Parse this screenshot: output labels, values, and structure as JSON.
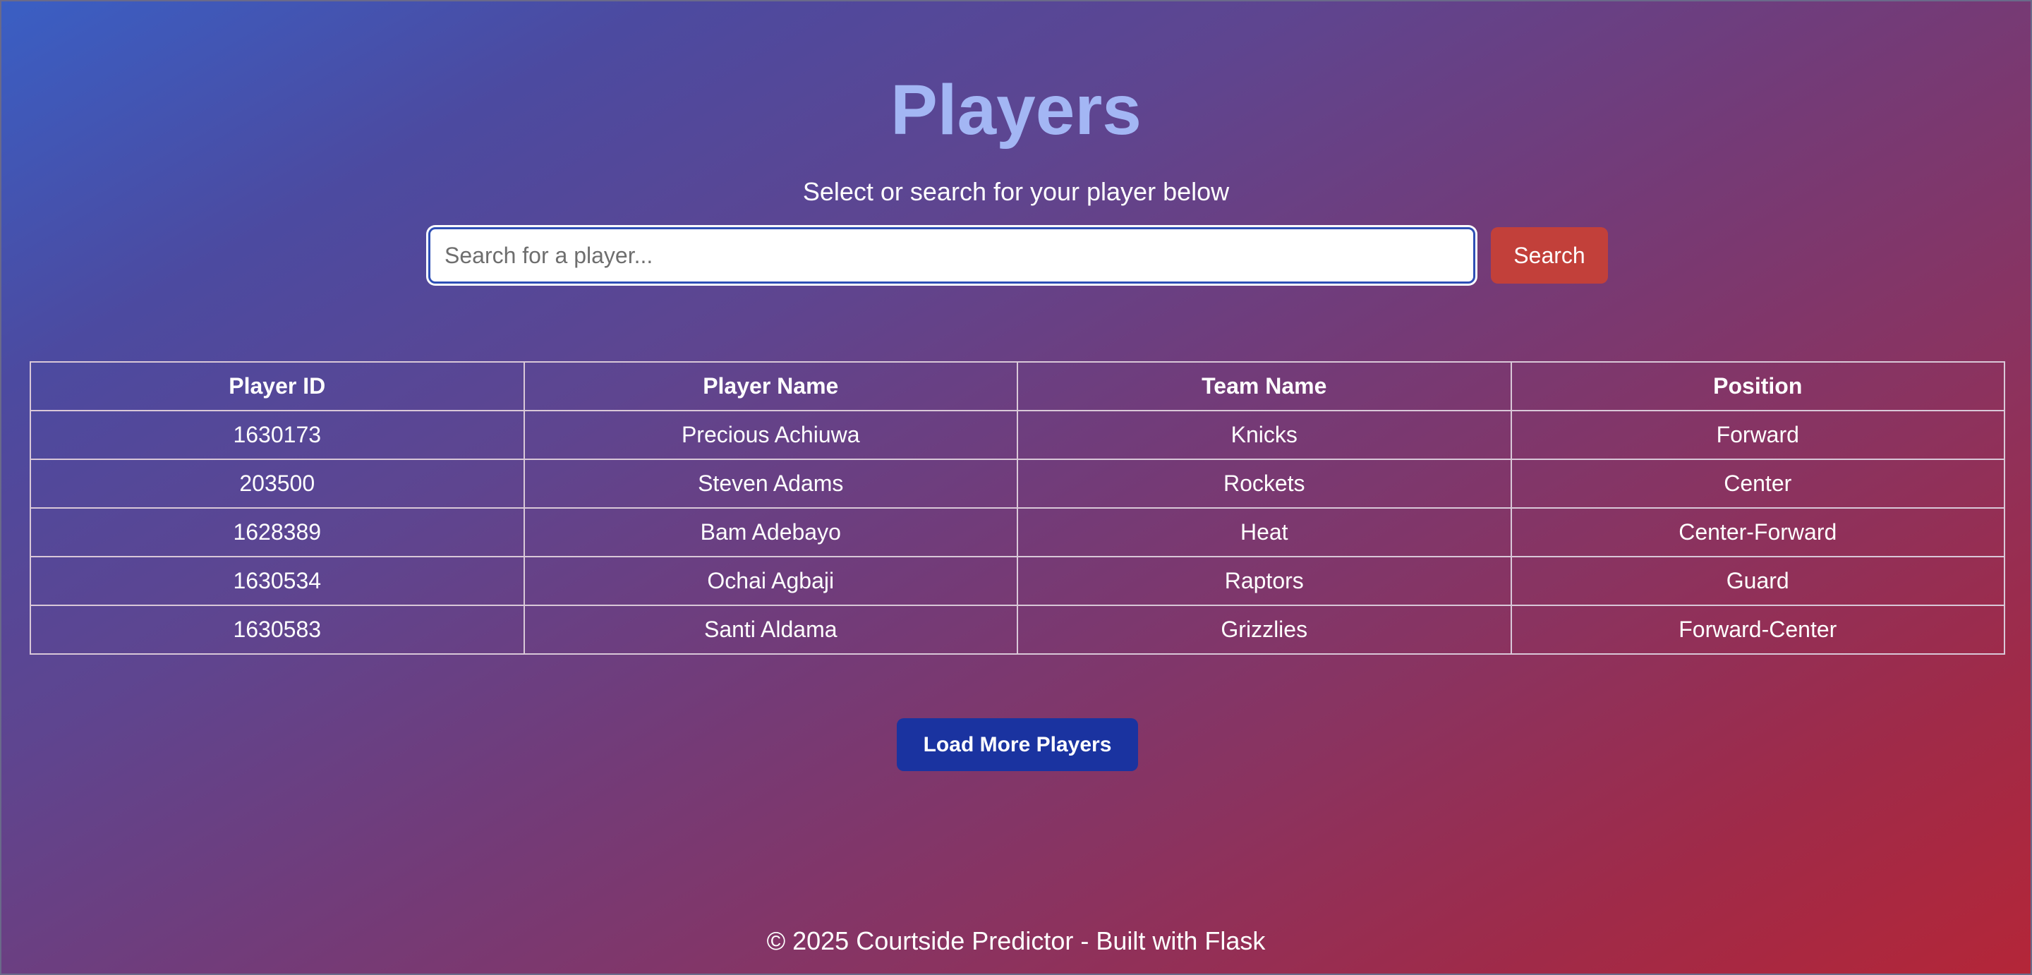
{
  "page": {
    "title": "Players",
    "subtitle": "Select or search for your player below"
  },
  "search": {
    "placeholder": "Search for a player...",
    "value": "",
    "button_label": "Search"
  },
  "table": {
    "columns": [
      "Player ID",
      "Player Name",
      "Team Name",
      "Position"
    ],
    "rows": [
      [
        "1630173",
        "Precious Achiuwa",
        "Knicks",
        "Forward"
      ],
      [
        "203500",
        "Steven Adams",
        "Rockets",
        "Center"
      ],
      [
        "1628389",
        "Bam Adebayo",
        "Heat",
        "Center-Forward"
      ],
      [
        "1630534",
        "Ochai Agbaji",
        "Raptors",
        "Guard"
      ],
      [
        "1630583",
        "Santi Aldama",
        "Grizzlies",
        "Forward-Center"
      ]
    ]
  },
  "load_more": {
    "label": "Load More Players"
  },
  "footer": {
    "text": "© 2025 Courtside Predictor - Built with Flask"
  },
  "colors": {
    "title": "#a3b6f4",
    "search_button": "#c2403a",
    "load_more_button": "#1a33a0",
    "gradient_start": "#3a5fc4",
    "gradient_end": "#b42638"
  }
}
